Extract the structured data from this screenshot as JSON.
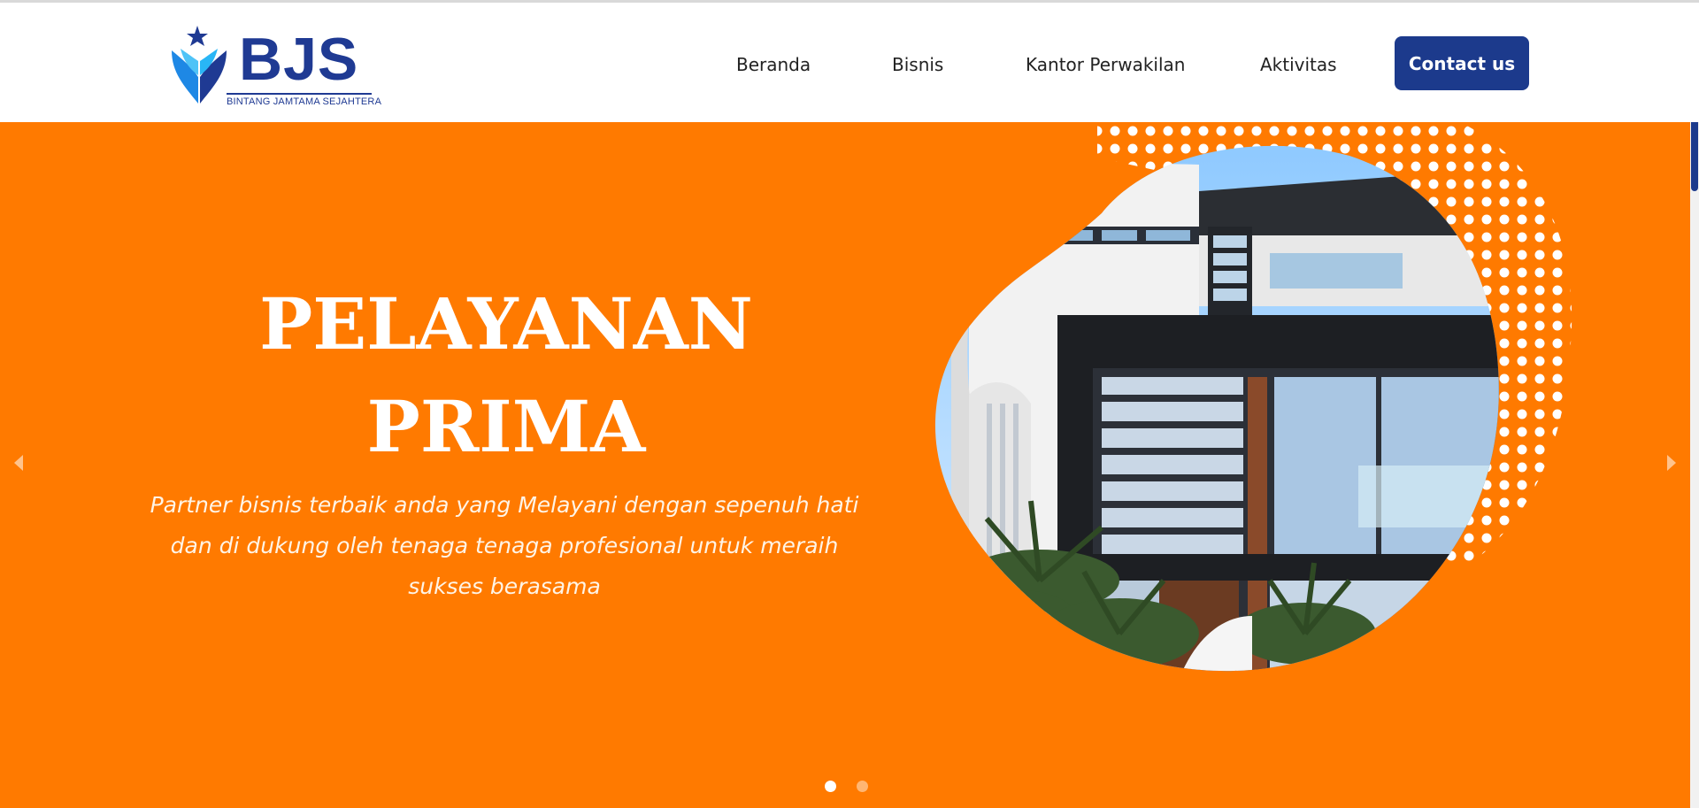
{
  "brand": {
    "name": "BJS",
    "tagline": "BINTANG JAMTAMA SEJAHTERA",
    "primary_color": "#1c3a8c",
    "accent_color": "#ff7a00"
  },
  "nav": {
    "items": [
      {
        "label": "Beranda"
      },
      {
        "label": "Bisnis"
      },
      {
        "label": "Kantor Perwakilan"
      },
      {
        "label": "Aktivitas"
      }
    ],
    "contact_label": "Contact us"
  },
  "hero": {
    "title_line1": "PELAYANAN",
    "title_line2": "PRIMA",
    "subtitle_line1": "Partner bisnis terbaik anda yang Melayani dengan sepenuh hati",
    "subtitle_line2": "dan di dukung oleh tenaga tenaga profesional untuk meraih",
    "subtitle_line3": "sukses berasama",
    "image": "modern-house-photo",
    "slides_total": 2,
    "active_slide": 1,
    "prev_icon": "caret-left-icon",
    "next_icon": "caret-right-icon"
  }
}
